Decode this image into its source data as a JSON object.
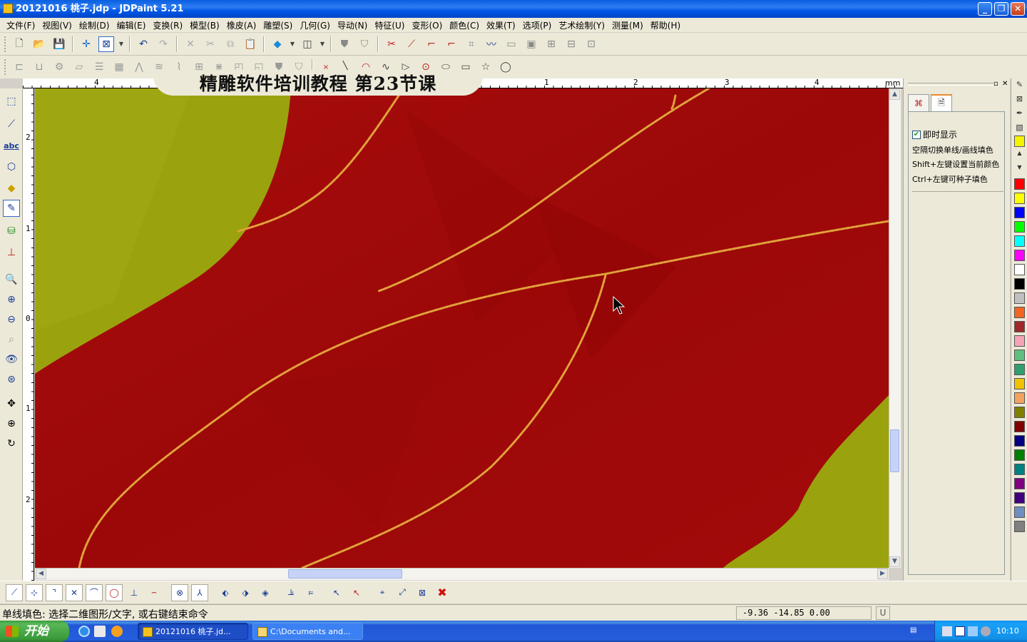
{
  "window": {
    "title": "20121016 桃子.jdp - JDPaint 5.21"
  },
  "menu": [
    "文件(F)",
    "视图(V)",
    "绘制(D)",
    "编辑(E)",
    "变换(R)",
    "模型(B)",
    "橡皮(A)",
    "雕塑(S)",
    "几何(G)",
    "导动(N)",
    "特征(U)",
    "变形(O)",
    "颜色(C)",
    "效果(T)",
    "选项(P)",
    "艺术绘制(Y)",
    "测量(M)",
    "帮助(H)"
  ],
  "banner": "精雕软件培训教程  第23节课",
  "ruler": {
    "h_labels": [
      "4",
      "1",
      "2",
      "3",
      "4"
    ],
    "unit": "mm",
    "v_labels": [
      "2",
      "1",
      "0",
      "1",
      "2"
    ]
  },
  "panel": {
    "checkbox_label": "即时显示",
    "hints": [
      "空隔切换单线/画线填色",
      "Shift+左键设置当前颜色",
      "Ctrl+左键可种子填色"
    ]
  },
  "palette": [
    "#ff0000",
    "#ffff00",
    "#0000ff",
    "#00ff00",
    "#00ffff",
    "#ff00ff",
    "#ffffff",
    "#000000",
    "#c0c0c0",
    "#f26522",
    "#a0282a",
    "#f5a3b5",
    "#5fbf7f",
    "#2f9f6f",
    "#f2c200",
    "#f2a35f",
    "#808000",
    "#800000",
    "#000080",
    "#008000",
    "#008080",
    "#800080",
    "#400080",
    "#6f8fbf",
    "#808080"
  ],
  "colors": {
    "canvas_red": "#a30a0a",
    "canvas_olive": "#9aa30d",
    "curve": "#e0a23a"
  },
  "status": {
    "text": "单线填色: 选择二维图形/文字, 或右键结束命令",
    "coords": "-9.36 -14.85 0.00",
    "unit_btn": "U"
  },
  "taskbar": {
    "start": "开始",
    "tasks": [
      "20121016 桃子.jd...",
      "C:\\Documents and..."
    ],
    "clock": "10:10"
  }
}
